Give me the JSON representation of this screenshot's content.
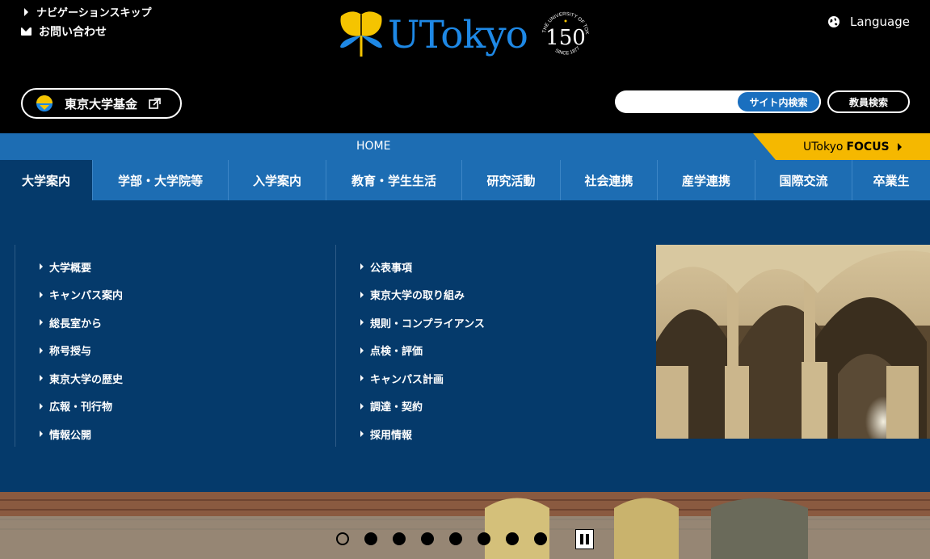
{
  "header": {
    "skip_nav": "ナビゲーションスキップ",
    "contact": "お問い合わせ",
    "logo_text": "UTokyo",
    "seal_number": "150",
    "seal_top": "THE UNIVERSITY OF TOKYO",
    "seal_bottom": "SINCE 1877",
    "language": "Language",
    "fund_label": "東京大学基金",
    "search_placeholder": "",
    "search_button": "サイト内検索",
    "faculty_search": "教員検索"
  },
  "homebar": {
    "home": "HOME",
    "focus_prefix": "UTokyo",
    "focus_bold": "FOCUS"
  },
  "nav": {
    "tabs": [
      {
        "label": "大学案内"
      },
      {
        "label": "学部・大学院等"
      },
      {
        "label": "入学案内"
      },
      {
        "label": "教育・学生生活"
      },
      {
        "label": "研究活動"
      },
      {
        "label": "社会連携"
      },
      {
        "label": "産学連携"
      },
      {
        "label": "国際交流"
      },
      {
        "label": "卒業生"
      }
    ]
  },
  "panel": {
    "col1": [
      "大学概要",
      "キャンパス案内",
      "総長室から",
      "称号授与",
      "東京大学の歴史",
      "広報・刊行物",
      "情報公開"
    ],
    "col2": [
      "公表事項",
      "東京大学の取り組み",
      "規則・コンプライアンス",
      "点検・評価",
      "キャンパス計画",
      "調達・契約",
      "採用情報"
    ]
  },
  "carousel": {
    "slide_count": 8,
    "active_index": 0
  },
  "colors": {
    "accent_blue": "#1d6db3",
    "panel_navy": "#053a6b",
    "focus_yellow": "#f5b800",
    "logo_blue": "#1e88e5"
  }
}
